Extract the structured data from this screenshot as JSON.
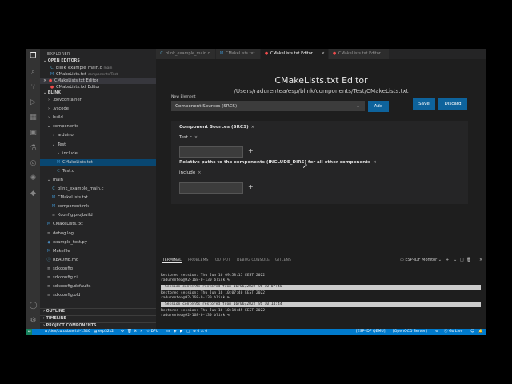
{
  "sidebar": {
    "title": "EXPLORER",
    "open_editors_header": "OPEN EDITORS",
    "open_editors": [
      {
        "name": "blink_example_main.c",
        "desc": "main",
        "icon": "c-file-icon"
      },
      {
        "name": "CMakeLists.txt",
        "desc": "components/Test",
        "icon": "cmake-file-icon"
      },
      {
        "name": "CMakeLists.txt Editor",
        "desc": "",
        "icon": "error-icon"
      },
      {
        "name": "CMakeLists.txt Editor",
        "desc": "",
        "icon": "error-icon"
      }
    ],
    "workspace_header": "BLINK",
    "tree": [
      {
        "name": ".devcontainer",
        "type": "folder",
        "collapsed": "›"
      },
      {
        "name": ".vscode",
        "type": "folder",
        "collapsed": "›"
      },
      {
        "name": "build",
        "type": "folder",
        "collapsed": "›"
      },
      {
        "name": "components",
        "type": "folder",
        "collapsed": "⌄"
      },
      {
        "name": "arduino",
        "type": "folder",
        "collapsed": "›"
      },
      {
        "name": "Test",
        "type": "folder",
        "collapsed": "⌄"
      },
      {
        "name": "include",
        "type": "folder",
        "collapsed": "›"
      },
      {
        "name": "CMakeLists.txt",
        "type": "M"
      },
      {
        "name": "Test.c",
        "type": "C"
      },
      {
        "name": "main",
        "type": "folder",
        "collapsed": "⌄"
      },
      {
        "name": "blink_example_main.c",
        "type": "C"
      },
      {
        "name": "CMakeLists.txt",
        "type": "M"
      },
      {
        "name": "component.mk",
        "type": "M"
      },
      {
        "name": "Kconfig.projbuild",
        "type": "cfg"
      },
      {
        "name": "CMakeLists.txt",
        "type": "M"
      },
      {
        "name": "debug.log",
        "type": "log"
      },
      {
        "name": "example_test.py",
        "type": "py"
      },
      {
        "name": "Makefile",
        "type": "M"
      },
      {
        "name": "README.md",
        "type": "md"
      },
      {
        "name": "sdkconfig",
        "type": "cfg"
      },
      {
        "name": "sdkconfig.ci",
        "type": "cfg"
      },
      {
        "name": "sdkconfig.defaults",
        "type": "cfg"
      },
      {
        "name": "sdkconfig.old",
        "type": "cfg"
      }
    ],
    "outline_header": "OUTLINE",
    "timeline_header": "TIMELINE",
    "project_components_header": "PROJECT COMPONENTS"
  },
  "tabs": [
    {
      "label": "blink_example_main.c",
      "icon": "c-file-icon"
    },
    {
      "label": "CMakeLists.txt",
      "icon": "cmake-file-icon"
    },
    {
      "label": "CMakeLists.txt Editor",
      "icon": "error-icon",
      "active": true
    },
    {
      "label": "CMakeLists.txt Editor",
      "icon": "error-icon"
    }
  ],
  "editor": {
    "title": "CMakeLists.txt Editor",
    "path": "/Users/radurentea/esp/blink/components/Test/CMakeLists.txt",
    "new_element_label": "New Element",
    "select_value": "Component Sources (SRCS)",
    "add_button": "Add",
    "save_button": "Save",
    "discard_button": "Discard",
    "sections": [
      {
        "title": "Component Sources (SRCS)",
        "items": [
          "Test.c"
        ],
        "add_symbol": "+"
      },
      {
        "title": "Relative paths to the components (INCLUDE_DIRS) for all other components",
        "items": [
          "include"
        ],
        "add_symbol": "+"
      }
    ],
    "remove_symbol": "×"
  },
  "panel": {
    "tabs": [
      "TERMINAL",
      "PROBLEMS",
      "OUTPUT",
      "DEBUG CONSOLE",
      "GITLENS"
    ],
    "terminal_name": "ESP-IDF Monitor",
    "lines": [
      {
        "text": "Restored session: Thu Jun 16 09:58:15 EEST 2022",
        "bar": false
      },
      {
        "text": "radurentea@92-168-0-130 blink % ",
        "bar": false
      },
      {
        "text": "Session contents restored from 16/06/2022 at 10:07:40",
        "bar": true
      },
      {
        "text": "Restored session: Thu Jun 16 10:07:40 EEST 2022",
        "bar": false
      },
      {
        "text": "radurentea@92-168-0-130 blink % ",
        "bar": false
      },
      {
        "text": "Session contents restored from 16/06/2022 at 10:14:44",
        "bar": true
      },
      {
        "text": "Restored session: Thu Jun 16 10:14:45 EEST 2022",
        "bar": false
      },
      {
        "text": "radurentea@92-168-0-130 blink % ",
        "bar": false
      }
    ]
  },
  "statusbar": {
    "items": [
      "/dev/cu.usbserial-1340",
      "esp32s2",
      "DFU",
      "[ESP-IDF QEMU]",
      "[OpenOCD Server]",
      "Go Live"
    ],
    "problems_errors": "0",
    "problems_warnings": "0"
  }
}
